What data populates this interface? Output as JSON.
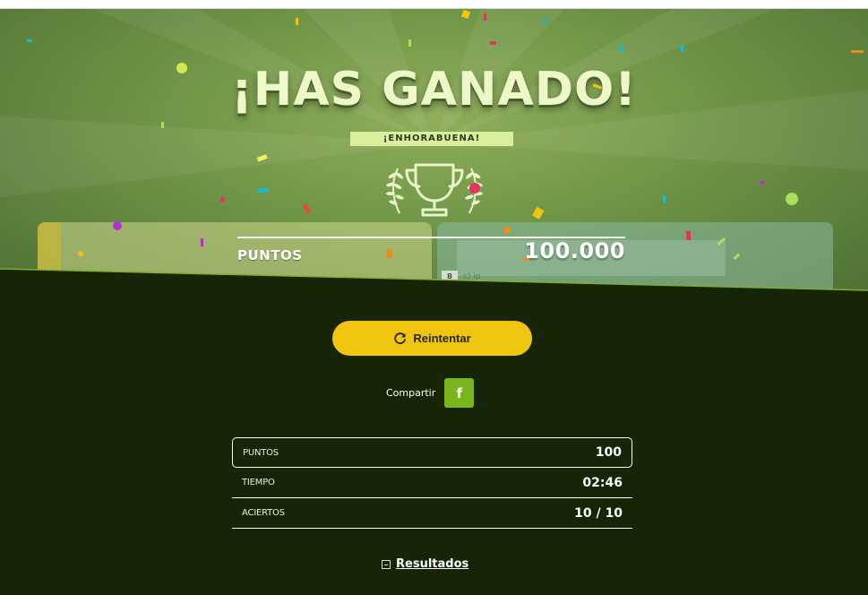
{
  "hero": {
    "title": "¡HAS GANADO!",
    "subtitle": "¡ENHORABUENA!",
    "score_label": "PUNTOS",
    "score_value": "100.000",
    "clip_text": "c) ip",
    "clip_badge": "B"
  },
  "actions": {
    "retry_label": "Reintentar",
    "share_label": "Compartir",
    "facebook_glyph": "f"
  },
  "stats": [
    {
      "label": "PUNTOS",
      "value": "100"
    },
    {
      "label": "TIEMPO",
      "value": "02:46"
    },
    {
      "label": "ACIERTOS",
      "value": "10 / 10"
    }
  ],
  "results_link": "Resultados",
  "colors": {
    "accent_yellow": "#f0c50f",
    "facebook_green": "#79b61e",
    "dark_background": "#162507",
    "hero_green": "#6f9447"
  },
  "icons": [
    "trophy-icon",
    "laurel-left-icon",
    "laurel-right-icon",
    "refresh-icon",
    "facebook-icon",
    "collapse-icon"
  ]
}
